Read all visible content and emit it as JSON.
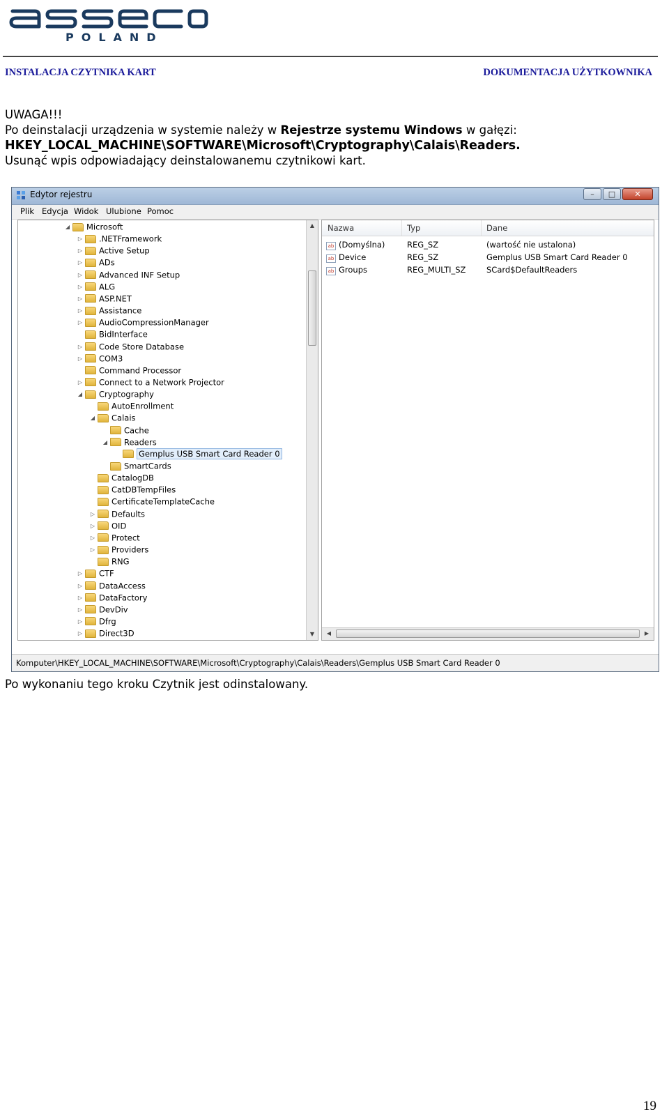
{
  "logo": {
    "brand": "asseco",
    "sub": "POLAND",
    "color": "#1a3a5e"
  },
  "header": {
    "left": "INSTALACJA CZYTNIKA KART",
    "right": "DOKUMENTACJA  UŻYTKOWNIKA",
    "color": "#1a1a9a"
  },
  "notice": {
    "title": "UWAGA!!!",
    "line1_a": "Po deinstalacji urządzenia w systemie należy w ",
    "line1_b": "Rejestrze systemu Windows",
    "line1_c": " w gałęzi:",
    "path": "HKEY_LOCAL_MACHINE\\SOFTWARE\\Microsoft\\Cryptography\\Calais\\Readers.",
    "line3": "Usunąć wpis odpowiadający deinstalowanemu czytnikowi kart."
  },
  "window": {
    "title": "Edytor rejestru",
    "buttons": {
      "minimize": "–",
      "maximize": "□",
      "close": "✕"
    },
    "menu": [
      "Plik",
      "Edycja",
      "Widok",
      "Ulubione",
      "Pomoc"
    ],
    "tree": [
      {
        "label": "Microsoft",
        "depth": 0,
        "expander": "◢"
      },
      {
        "label": ".NETFramework",
        "depth": 1,
        "expander": "▷"
      },
      {
        "label": "Active Setup",
        "depth": 1,
        "expander": "▷"
      },
      {
        "label": "ADs",
        "depth": 1,
        "expander": "▷"
      },
      {
        "label": "Advanced INF Setup",
        "depth": 1,
        "expander": "▷"
      },
      {
        "label": "ALG",
        "depth": 1,
        "expander": "▷"
      },
      {
        "label": "ASP.NET",
        "depth": 1,
        "expander": "▷"
      },
      {
        "label": "Assistance",
        "depth": 1,
        "expander": "▷"
      },
      {
        "label": "AudioCompressionManager",
        "depth": 1,
        "expander": "▷"
      },
      {
        "label": "BidInterface",
        "depth": 1,
        "expander": ""
      },
      {
        "label": "Code Store Database",
        "depth": 1,
        "expander": "▷"
      },
      {
        "label": "COM3",
        "depth": 1,
        "expander": "▷"
      },
      {
        "label": "Command Processor",
        "depth": 1,
        "expander": ""
      },
      {
        "label": "Connect to a Network Projector",
        "depth": 1,
        "expander": "▷"
      },
      {
        "label": "Cryptography",
        "depth": 1,
        "expander": "◢"
      },
      {
        "label": "AutoEnrollment",
        "depth": 2,
        "expander": ""
      },
      {
        "label": "Calais",
        "depth": 2,
        "expander": "◢"
      },
      {
        "label": "Cache",
        "depth": 3,
        "expander": ""
      },
      {
        "label": "Readers",
        "depth": 3,
        "expander": "◢"
      },
      {
        "label": "Gemplus USB Smart Card Reader 0",
        "depth": 4,
        "expander": "",
        "selected": true
      },
      {
        "label": "SmartCards",
        "depth": 3,
        "expander": ""
      },
      {
        "label": "CatalogDB",
        "depth": 2,
        "expander": ""
      },
      {
        "label": "CatDBTempFiles",
        "depth": 2,
        "expander": ""
      },
      {
        "label": "CertificateTemplateCache",
        "depth": 2,
        "expander": ""
      },
      {
        "label": "Defaults",
        "depth": 2,
        "expander": "▷"
      },
      {
        "label": "OID",
        "depth": 2,
        "expander": "▷"
      },
      {
        "label": "Protect",
        "depth": 2,
        "expander": "▷"
      },
      {
        "label": "Providers",
        "depth": 2,
        "expander": "▷"
      },
      {
        "label": "RNG",
        "depth": 2,
        "expander": ""
      },
      {
        "label": "CTF",
        "depth": 1,
        "expander": "▷"
      },
      {
        "label": "DataAccess",
        "depth": 1,
        "expander": "▷"
      },
      {
        "label": "DataFactory",
        "depth": 1,
        "expander": "▷"
      },
      {
        "label": "DevDiv",
        "depth": 1,
        "expander": "▷"
      },
      {
        "label": "Dfrg",
        "depth": 1,
        "expander": "▷"
      },
      {
        "label": "Direct3D",
        "depth": 1,
        "expander": "▷"
      }
    ],
    "list": {
      "columns": [
        "Nazwa",
        "Typ",
        "Dane"
      ],
      "rows": [
        {
          "name": "(Domyślna)",
          "type": "REG_SZ",
          "data": "(wartość nie ustalona)"
        },
        {
          "name": "Device",
          "type": "REG_SZ",
          "data": "Gemplus USB Smart Card Reader 0"
        },
        {
          "name": "Groups",
          "type": "REG_MULTI_SZ",
          "data": "SCard$DefaultReaders"
        }
      ]
    },
    "status": "Komputer\\HKEY_LOCAL_MACHINE\\SOFTWARE\\Microsoft\\Cryptography\\Calais\\Readers\\Gemplus USB Smart Card Reader 0"
  },
  "after_text": "Po wykonaniu tego kroku Czytnik jest odinstalowany.",
  "page_number": "19"
}
